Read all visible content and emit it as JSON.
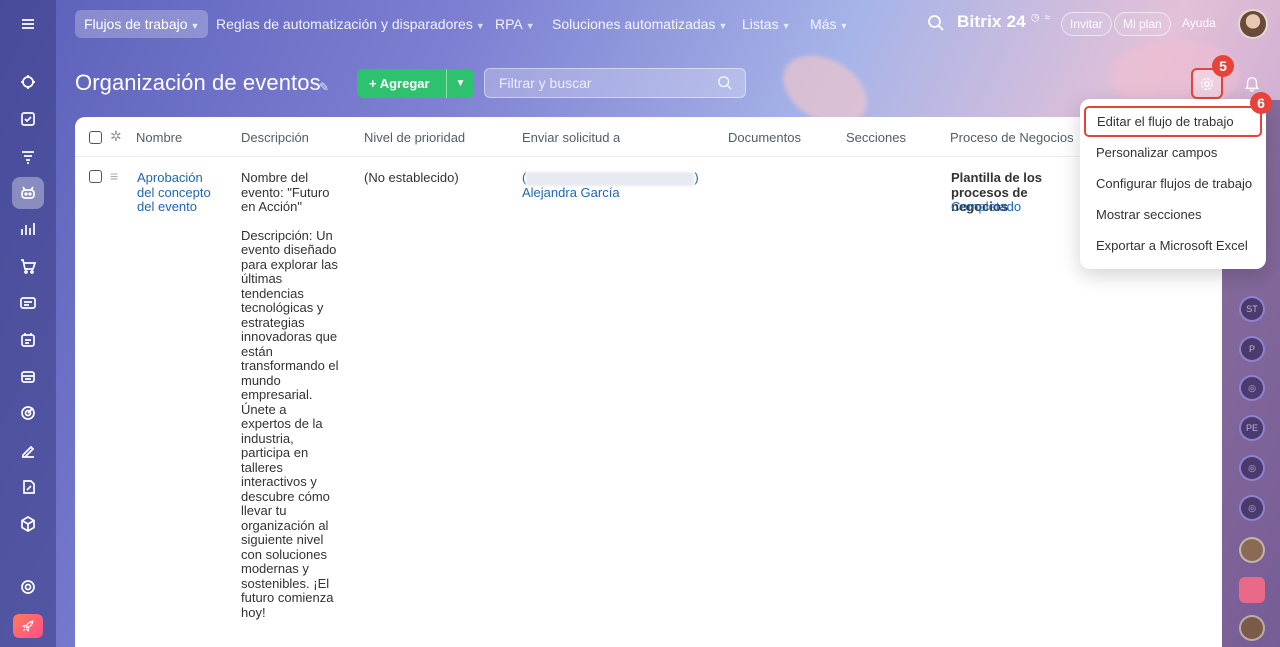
{
  "topnav": {
    "items": [
      {
        "label": "Flujos de trabajo",
        "active": true
      },
      {
        "label": "Reglas de automatización y disparadores"
      },
      {
        "label": "RPA"
      },
      {
        "label": "Soluciones automatizadas"
      },
      {
        "label": "Listas"
      },
      {
        "label": "Más"
      }
    ],
    "brand": "Bitrix 24",
    "invite": "Invitar",
    "plan": "Mi plan",
    "help": "Ayuda"
  },
  "header": {
    "title": "Organización de eventos",
    "add_label": "+ Agregar",
    "filter_placeholder": "Filtrar y buscar",
    "badge_gear": "5",
    "badge_menu": "6"
  },
  "table": {
    "columns": [
      "Nombre",
      "Descripción",
      "Nivel de prioridad",
      "Enviar solicitud a",
      "Documentos",
      "Secciones",
      "Proceso de Negocios"
    ],
    "rows": [
      {
        "name": "Aprobación del concepto del evento",
        "description_1": "Nombre del evento: \"Futuro en Acción\"",
        "description_2": "Descripción: Un evento diseñado para explorar las últimas tendencias tecnológicas y estrategias innovadoras que están transformando el mundo empresarial. Únete a expertos de la industria, participa en talleres interactivos y descubre cómo llevar tu organización al siguiente nivel con soluciones modernas y sostenibles. ¡El futuro comienza hoy!",
        "priority": "(No establecido)",
        "request_open": "(",
        "request_close": ")",
        "request_to": "Alejandra García",
        "process_title": "Plantilla de los procesos de negocios",
        "process_status": "Completado"
      }
    ]
  },
  "menu": {
    "items": [
      "Editar el flujo de trabajo",
      "Personalizar campos",
      "Configurar flujos de trabajo",
      "Mostrar secciones",
      "Exportar a Microsoft Excel"
    ]
  },
  "right_rail": {
    "initials": [
      "ST",
      "P",
      "",
      "PE",
      "",
      ""
    ]
  },
  "colors": {
    "accent_green": "#2fc26e",
    "highlight_red": "#e7433a",
    "link_blue": "#2067b0"
  }
}
